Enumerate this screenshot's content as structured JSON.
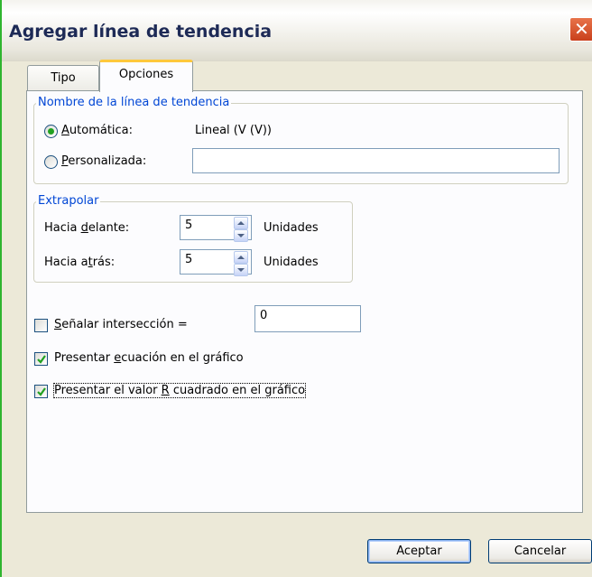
{
  "window": {
    "title": "Agregar línea de tendencia",
    "close_symbol": "✕"
  },
  "tabs": [
    {
      "label": "Tipo",
      "active": false
    },
    {
      "label": "Opciones",
      "active": true
    }
  ],
  "name_group": {
    "legend": "Nombre de la línea de tendencia",
    "auto_label": "Automática:",
    "auto_value": "Lineal (V (V))",
    "auto_selected": true,
    "custom_label": "Personalizada:",
    "custom_value": ""
  },
  "extrapolate": {
    "legend": "Extrapolar",
    "forward_label": "Hacia delante:",
    "forward_value": "5",
    "backward_label": "Hacia atrás:",
    "backward_value": "5",
    "units_label": "Unidades"
  },
  "options": {
    "intercept_label": "Señalar intersección =",
    "intercept_checked": false,
    "intercept_value": "0",
    "equation_label": "Presentar ecuación en el gráfico",
    "equation_checked": true,
    "rsquared_label": "Presentar el valor R cuadrado en el gráfico",
    "rsquared_checked": true
  },
  "buttons": {
    "ok": "Aceptar",
    "cancel": "Cancelar"
  },
  "colors": {
    "accent_green": "#21a121",
    "group_legend": "#0046d5",
    "tab_highlight": "#ffc83c"
  }
}
